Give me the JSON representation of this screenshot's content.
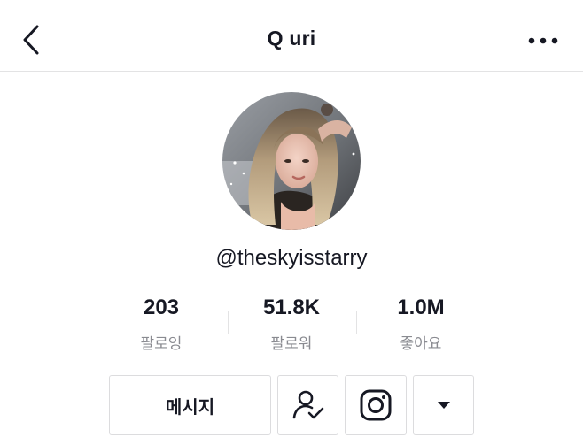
{
  "header": {
    "title": "Q uri"
  },
  "profile": {
    "username": "@theskyisstarry"
  },
  "stats": [
    {
      "value": "203",
      "label": "팔로잉"
    },
    {
      "value": "51.8K",
      "label": "팔로워"
    },
    {
      "value": "1.0M",
      "label": "좋아요"
    }
  ],
  "actions": {
    "message_label": "메시지"
  },
  "icons": {
    "back": "chevron-left-icon",
    "more": "more-horizontal-icon",
    "followed": "user-check-icon",
    "instagram": "instagram-icon",
    "dropdown": "triangle-down-icon"
  }
}
